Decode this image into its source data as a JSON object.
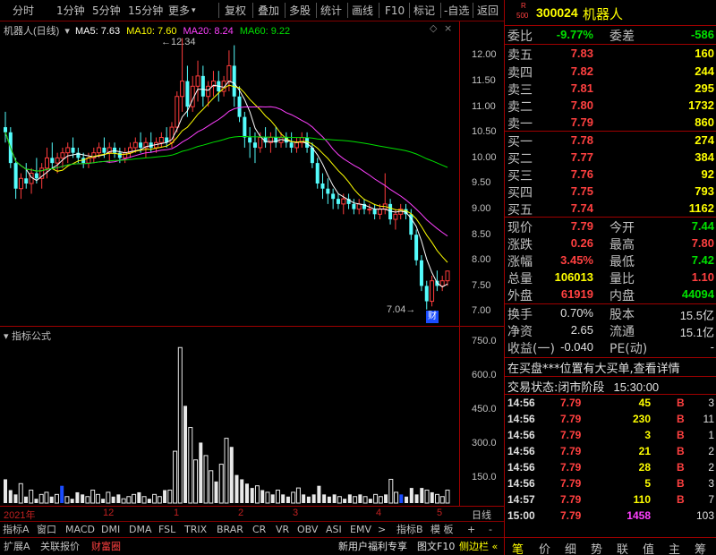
{
  "toolbar": {
    "periods": [
      "分时",
      "1分钟",
      "5分钟",
      "15分钟",
      "更多"
    ],
    "actions": [
      "复权",
      "叠加",
      "多股",
      "统计",
      "画线",
      "F10",
      "标记",
      "-自选",
      "返回"
    ]
  },
  "chart_header": {
    "name": "机器人(日线)",
    "ma5": "MA5: 7.63",
    "ma10": "MA10: 7.60",
    "ma20": "MA20: 8.24",
    "ma60": "MA60: 9.22",
    "colors": {
      "ma5": "#ffffff",
      "ma10": "#ffff00",
      "ma20": "#ff40ff",
      "ma60": "#00e000"
    }
  },
  "price_axis": [
    "12.00",
    "11.50",
    "11.00",
    "10.50",
    "10.00",
    "9.50",
    "9.00",
    "8.50",
    "8.00",
    "7.50",
    "7.00"
  ],
  "annotations": {
    "high": "12.34",
    "low": "7.04",
    "cai": "财"
  },
  "volume_header": "指标公式",
  "volume_axis": [
    "750.0",
    "600.0",
    "450.0",
    "300.0",
    "150.0"
  ],
  "xaxis": [
    "2021年",
    "12",
    "1",
    "2",
    "3",
    "4",
    "5"
  ],
  "xaxis_right": "日线",
  "chart_data": [
    {
      "type": "candlestick",
      "title": "机器人(日线)",
      "ylim": [
        7.0,
        12.34
      ],
      "grid": false,
      "series": [
        {
          "name": "MA5",
          "values": [
            7.63
          ]
        },
        {
          "name": "MA10",
          "values": [
            7.6
          ]
        },
        {
          "name": "MA20",
          "values": [
            8.24
          ]
        },
        {
          "name": "MA60",
          "values": [
            9.22
          ]
        }
      ],
      "ohlc": [
        [
          10.6,
          10.9,
          10.3,
          10.5
        ],
        [
          10.5,
          10.6,
          9.8,
          9.9
        ],
        [
          9.9,
          10.0,
          9.2,
          9.4
        ],
        [
          9.4,
          9.7,
          9.2,
          9.6
        ],
        [
          9.6,
          9.9,
          9.4,
          9.5
        ],
        [
          9.5,
          9.8,
          9.3,
          9.7
        ],
        [
          9.7,
          10.0,
          9.5,
          9.6
        ],
        [
          9.6,
          9.9,
          9.4,
          9.8
        ],
        [
          9.8,
          10.2,
          9.6,
          10.0
        ],
        [
          10.0,
          10.3,
          9.8,
          9.9
        ],
        [
          9.9,
          10.1,
          9.7,
          10.0
        ],
        [
          10.0,
          10.2,
          9.8,
          10.1
        ],
        [
          10.1,
          10.3,
          9.9,
          10.2
        ],
        [
          10.2,
          10.4,
          10.0,
          10.1
        ],
        [
          10.1,
          10.2,
          9.9,
          10.0
        ],
        [
          10.0,
          10.1,
          9.8,
          9.9
        ],
        [
          9.9,
          10.1,
          9.8,
          10.0
        ],
        [
          10.0,
          10.2,
          9.9,
          10.1
        ],
        [
          10.1,
          10.3,
          10.0,
          10.2
        ],
        [
          10.2,
          10.4,
          10.0,
          10.1
        ],
        [
          10.1,
          10.3,
          9.9,
          10.2
        ],
        [
          10.2,
          10.3,
          10.0,
          10.1
        ],
        [
          10.1,
          10.2,
          9.9,
          10.0
        ],
        [
          10.0,
          10.2,
          9.9,
          10.1
        ],
        [
          10.1,
          10.3,
          10.0,
          10.2
        ],
        [
          10.2,
          10.4,
          10.1,
          10.3
        ],
        [
          10.3,
          10.5,
          10.1,
          10.2
        ],
        [
          10.2,
          10.4,
          10.0,
          10.3
        ],
        [
          10.3,
          10.5,
          10.1,
          10.2
        ],
        [
          10.2,
          10.4,
          10.1,
          10.3
        ],
        [
          10.3,
          10.5,
          10.2,
          10.4
        ],
        [
          10.4,
          10.6,
          10.2,
          10.3
        ],
        [
          10.3,
          10.7,
          10.2,
          10.6
        ],
        [
          10.6,
          11.3,
          10.5,
          11.2
        ],
        [
          11.2,
          12.34,
          10.9,
          11.5
        ],
        [
          11.5,
          11.8,
          10.8,
          11.0
        ],
        [
          11.0,
          11.6,
          10.9,
          11.4
        ],
        [
          11.4,
          11.9,
          11.1,
          11.6
        ],
        [
          11.6,
          11.8,
          11.0,
          11.2
        ],
        [
          11.2,
          11.5,
          11.0,
          11.4
        ],
        [
          11.4,
          11.7,
          11.2,
          11.5
        ],
        [
          11.5,
          11.7,
          11.1,
          11.3
        ],
        [
          11.3,
          11.6,
          11.2,
          11.5
        ],
        [
          11.5,
          12.1,
          11.3,
          11.8
        ],
        [
          11.8,
          12.2,
          11.0,
          11.2
        ],
        [
          11.2,
          11.4,
          10.7,
          10.8
        ],
        [
          10.8,
          10.9,
          10.2,
          10.4
        ],
        [
          10.4,
          10.6,
          10.0,
          10.3
        ],
        [
          10.3,
          10.5,
          9.9,
          10.2
        ],
        [
          10.2,
          10.5,
          10.1,
          10.4
        ],
        [
          10.4,
          10.6,
          10.2,
          10.3
        ],
        [
          10.3,
          10.5,
          10.1,
          10.4
        ],
        [
          10.4,
          10.6,
          10.2,
          10.3
        ],
        [
          10.3,
          10.5,
          10.2,
          10.4
        ],
        [
          10.4,
          10.5,
          10.2,
          10.3
        ],
        [
          10.3,
          10.5,
          10.1,
          10.2
        ],
        [
          10.2,
          10.4,
          10.1,
          10.3
        ],
        [
          10.3,
          10.5,
          10.2,
          10.4
        ],
        [
          10.4,
          10.5,
          10.1,
          10.2
        ],
        [
          10.2,
          10.3,
          9.8,
          9.9
        ],
        [
          9.9,
          10.0,
          9.4,
          9.5
        ],
        [
          9.5,
          9.7,
          9.2,
          9.4
        ],
        [
          9.4,
          9.6,
          9.1,
          9.3
        ],
        [
          9.3,
          9.4,
          9.0,
          9.2
        ],
        [
          9.2,
          9.3,
          9.0,
          9.1
        ],
        [
          9.1,
          9.3,
          8.9,
          9.2
        ],
        [
          9.2,
          9.3,
          9.0,
          9.1
        ],
        [
          9.1,
          9.2,
          8.9,
          9.0
        ],
        [
          9.0,
          9.2,
          8.9,
          9.1
        ],
        [
          9.1,
          9.2,
          8.9,
          9.0
        ],
        [
          9.0,
          9.1,
          8.9,
          9.0
        ],
        [
          9.0,
          9.1,
          8.8,
          8.9
        ],
        [
          8.9,
          9.1,
          8.8,
          9.0
        ],
        [
          9.0,
          9.7,
          8.9,
          9.1
        ],
        [
          9.1,
          9.2,
          8.7,
          8.8
        ],
        [
          8.8,
          9.0,
          8.6,
          8.9
        ],
        [
          8.9,
          9.1,
          8.8,
          9.0
        ],
        [
          9.0,
          9.1,
          8.8,
          8.9
        ],
        [
          8.9,
          9.0,
          8.4,
          8.5
        ],
        [
          8.5,
          8.6,
          7.9,
          8.0
        ],
        [
          8.0,
          8.1,
          7.4,
          7.5
        ],
        [
          7.5,
          7.6,
          7.04,
          7.2
        ],
        [
          7.2,
          7.7,
          7.1,
          7.6
        ],
        [
          7.6,
          7.8,
          7.4,
          7.5
        ],
        [
          7.5,
          7.7,
          7.4,
          7.6
        ],
        [
          7.6,
          7.8,
          7.5,
          7.79
        ]
      ]
    },
    {
      "type": "bar",
      "title": "指标公式",
      "ylim": [
        0,
        800
      ],
      "values": [
        110,
        60,
        40,
        90,
        30,
        60,
        20,
        40,
        50,
        30,
        40,
        80,
        30,
        20,
        50,
        40,
        30,
        60,
        40,
        20,
        50,
        30,
        40,
        20,
        30,
        40,
        50,
        30,
        20,
        40,
        30,
        60,
        60,
        240,
        720,
        450,
        350,
        200,
        280,
        220,
        150,
        100,
        180,
        300,
        260,
        130,
        110,
        90,
        70,
        80,
        60,
        50,
        40,
        60,
        40,
        30,
        50,
        70,
        40,
        30,
        40,
        80,
        40,
        30,
        40,
        30,
        20,
        40,
        30,
        40,
        30,
        20,
        40,
        30,
        40,
        110,
        50,
        40,
        30,
        70,
        40,
        70,
        60,
        50,
        40,
        30,
        60
      ],
      "highlight_blue": [
        11,
        77
      ]
    }
  ],
  "bottom_tabs": [
    "指标A",
    "窗口",
    "MACD",
    "DMI",
    "DMA",
    "FSL",
    "TRIX",
    "BRAR",
    "CR",
    "VR",
    "OBV",
    "ASI",
    "EMV",
    ">"
  ],
  "bottom_right": [
    "指标B",
    "模 板",
    "+",
    "-"
  ],
  "footer": {
    "left": [
      "扩展A",
      "关联报价",
      "财富圈"
    ],
    "news": "新用户福利专享",
    "right": [
      "图文F10",
      "侧边栏 «"
    ]
  },
  "quote": {
    "code": "300024",
    "name": "机器人",
    "badge_r": "R",
    "badge_num": "500",
    "weibi_label": "委比",
    "weibi": "-9.77%",
    "weicha_label": "委差",
    "weicha": "-586",
    "asks": [
      {
        "label": "卖五",
        "price": "7.83",
        "vol": "160"
      },
      {
        "label": "卖四",
        "price": "7.82",
        "vol": "244"
      },
      {
        "label": "卖三",
        "price": "7.81",
        "vol": "295"
      },
      {
        "label": "卖二",
        "price": "7.80",
        "vol": "1732"
      },
      {
        "label": "卖一",
        "price": "7.79",
        "vol": "860"
      }
    ],
    "bids": [
      {
        "label": "买一",
        "price": "7.78",
        "vol": "274"
      },
      {
        "label": "买二",
        "price": "7.77",
        "vol": "384"
      },
      {
        "label": "买三",
        "price": "7.76",
        "vol": "92"
      },
      {
        "label": "买四",
        "price": "7.75",
        "vol": "793"
      },
      {
        "label": "买五",
        "price": "7.74",
        "vol": "1162"
      }
    ],
    "stats": [
      {
        "l1": "现价",
        "v1": "7.79",
        "c1": "red",
        "l2": "今开",
        "v2": "7.44",
        "c2": "grn"
      },
      {
        "l1": "涨跌",
        "v1": "0.26",
        "c1": "red",
        "l2": "最高",
        "v2": "7.80",
        "c2": "red"
      },
      {
        "l1": "涨幅",
        "v1": "3.45%",
        "c1": "red",
        "l2": "最低",
        "v2": "7.42",
        "c2": "grn"
      },
      {
        "l1": "总量",
        "v1": "106013",
        "c1": "yel",
        "l2": "量比",
        "v2": "1.10",
        "c2": "red"
      },
      {
        "l1": "外盘",
        "v1": "61919",
        "c1": "red",
        "l2": "内盘",
        "v2": "44094",
        "c2": "grn"
      }
    ],
    "stats2": [
      {
        "l1": "换手",
        "v1": "0.70%",
        "l2": "股本",
        "v2": "15.5亿"
      },
      {
        "l1": "净资",
        "v1": "2.65",
        "l2": "流通",
        "v2": "15.1亿"
      },
      {
        "l1": "收益(一)",
        "v1": "-0.040",
        "l2": "PE(动)",
        "v2": "-"
      }
    ],
    "news": "在买盘***位置有大买单,查看详情",
    "status_label": "交易状态:",
    "status_value": "闭市阶段",
    "status_time": "15:30:00",
    "ticks": [
      {
        "t": "14:56",
        "p": "7.79",
        "v": "45",
        "s": "B",
        "n": "3",
        "vc": "yel"
      },
      {
        "t": "14:56",
        "p": "7.79",
        "v": "230",
        "s": "B",
        "n": "11",
        "vc": "yel"
      },
      {
        "t": "14:56",
        "p": "7.79",
        "v": "3",
        "s": "B",
        "n": "1",
        "vc": "yel"
      },
      {
        "t": "14:56",
        "p": "7.79",
        "v": "21",
        "s": "B",
        "n": "2",
        "vc": "yel"
      },
      {
        "t": "14:56",
        "p": "7.79",
        "v": "28",
        "s": "B",
        "n": "2",
        "vc": "yel"
      },
      {
        "t": "14:56",
        "p": "7.79",
        "v": "5",
        "s": "B",
        "n": "3",
        "vc": "yel"
      },
      {
        "t": "14:57",
        "p": "7.79",
        "v": "110",
        "s": "B",
        "n": "7",
        "vc": "yel"
      },
      {
        "t": "15:00",
        "p": "7.79",
        "v": "1458",
        "s": "",
        "n": "103",
        "vc": "mag"
      }
    ],
    "tabs": [
      "笔",
      "价",
      "细",
      "势",
      "联",
      "值",
      "主",
      "筹"
    ]
  }
}
